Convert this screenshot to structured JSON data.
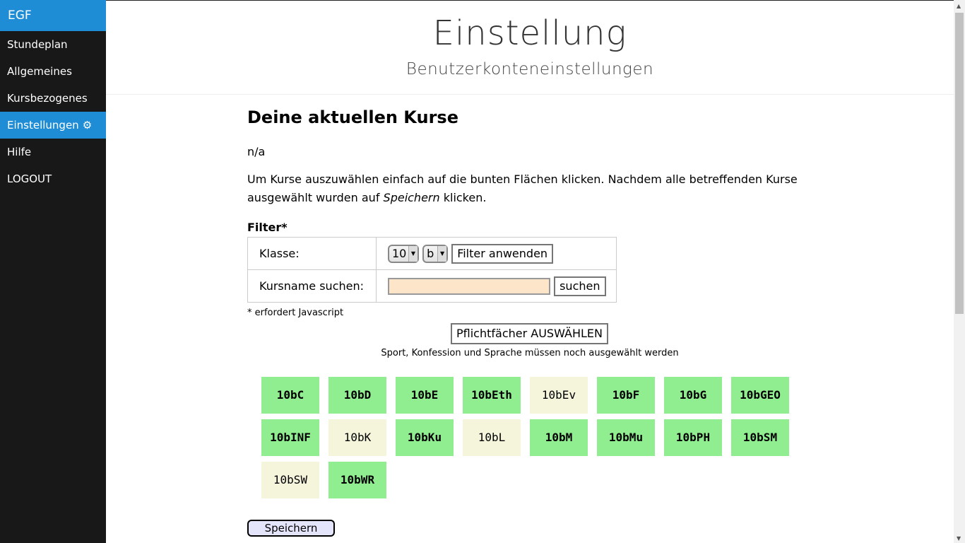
{
  "sidebar": {
    "brand": "EGF",
    "items": [
      {
        "label": "Stundeplan"
      },
      {
        "label": "Allgemeines"
      },
      {
        "label": "Kursbezogenes"
      },
      {
        "label": "Einstellungen",
        "icon": "gear-icon"
      },
      {
        "label": "Hilfe"
      },
      {
        "label": "LOGOUT"
      }
    ]
  },
  "header": {
    "title": "Einstellung",
    "subtitle": "Benutzerkonteneinstellungen"
  },
  "content": {
    "heading": "Deine aktuellen Kurse",
    "current_courses": "n/a",
    "intro_part1": "Um Kurse auszuwählen einfach auf die bunten Flächen klicken. Nachdem alle betreffenden Kurse ausgewählt wurden auf ",
    "intro_emphasis": "Speichern",
    "intro_part2": " klicken.",
    "filter_title": "Filter*",
    "filter": {
      "class_label": "Klasse:",
      "grade_value": "10",
      "class_value": "b",
      "apply_label": "Filter anwenden",
      "search_label": "Kursname suchen:",
      "search_value": "",
      "search_button": "suchen"
    },
    "js_note": "* erfordert Javascript",
    "pflicht_button": "Pflichtfächer AUSWÄHLEN",
    "pflicht_note": "Sport, Konfession und Sprache müssen noch ausgewählt werden",
    "courses": [
      {
        "name": "10bC",
        "selected": true
      },
      {
        "name": "10bD",
        "selected": true
      },
      {
        "name": "10bE",
        "selected": true
      },
      {
        "name": "10bEth",
        "selected": true
      },
      {
        "name": "10bEv",
        "selected": false
      },
      {
        "name": "10bF",
        "selected": true
      },
      {
        "name": "10bG",
        "selected": true
      },
      {
        "name": "10bGEO",
        "selected": true
      },
      {
        "name": "10bINF",
        "selected": true
      },
      {
        "name": "10bK",
        "selected": false
      },
      {
        "name": "10bKu",
        "selected": true
      },
      {
        "name": "10bL",
        "selected": false
      },
      {
        "name": "10bM",
        "selected": true
      },
      {
        "name": "10bMu",
        "selected": true
      },
      {
        "name": "10bPH",
        "selected": true
      },
      {
        "name": "10bSM",
        "selected": true
      },
      {
        "name": "10bSW",
        "selected": false
      },
      {
        "name": "10bWR",
        "selected": true
      }
    ],
    "save_label": "Speichern"
  },
  "colors": {
    "accent": "#1f8dd6",
    "sidebar_bg": "#191818",
    "selected_course": "#90ee90",
    "unselected_course": "#f5f5dc",
    "search_field_bg": "#fde5c9",
    "save_button_bg": "#e4e4fb"
  }
}
